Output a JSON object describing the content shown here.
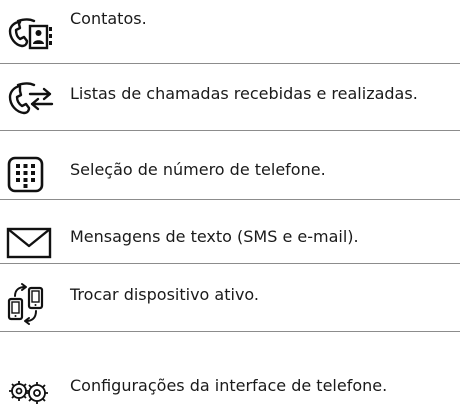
{
  "items": [
    {
      "icon": "contacts-phone-icon",
      "label": "Contatos."
    },
    {
      "icon": "call-lists-arrows-icon",
      "label": "Listas de chamadas recebidas e realizadas."
    },
    {
      "icon": "keypad-icon",
      "label": "Seleção de número de telefone."
    },
    {
      "icon": "envelope-icon",
      "label": "Mensagens de texto (SMS e e-mail)."
    },
    {
      "icon": "switch-device-icon",
      "label": "Trocar dispositivo ativo."
    },
    {
      "icon": "settings-gears-icon",
      "label": "Configurações da interface de telefone."
    }
  ]
}
